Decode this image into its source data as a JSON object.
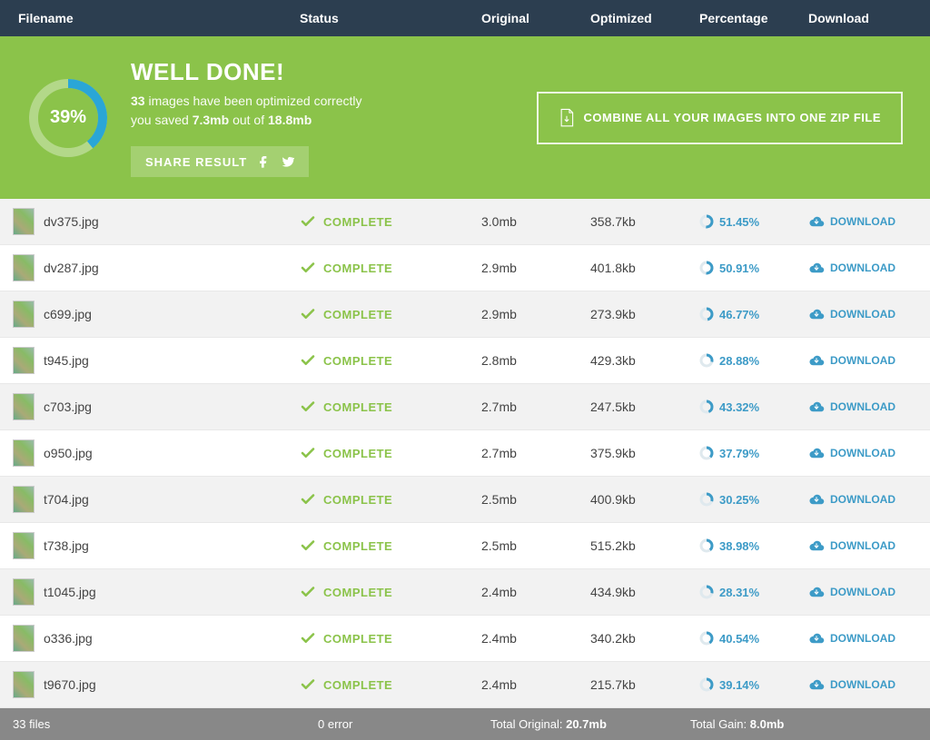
{
  "headers": {
    "file": "Filename",
    "status": "Status",
    "orig": "Original",
    "opt": "Optimized",
    "pct": "Percentage",
    "dl": "Download"
  },
  "hero": {
    "ring_pct": "39%",
    "ring_val": 39,
    "title": "WELL DONE!",
    "line1_a": "33",
    "line1_b": " images have been optimized correctly",
    "line2_a": "you saved ",
    "line2_b": "7.3mb",
    "line2_c": " out of ",
    "line2_d": "18.8mb",
    "share": "SHARE RESULT",
    "combine": "COMBINE ALL YOUR IMAGES INTO ONE ZIP FILE"
  },
  "status_label": "COMPLETE",
  "dl_label": "DOWNLOAD",
  "rows": [
    {
      "file": "dv375.jpg",
      "orig": "3.0mb",
      "opt": "358.7kb",
      "pct": "51.45%",
      "p": 51.45
    },
    {
      "file": "dv287.jpg",
      "orig": "2.9mb",
      "opt": "401.8kb",
      "pct": "50.91%",
      "p": 50.91
    },
    {
      "file": "c699.jpg",
      "orig": "2.9mb",
      "opt": "273.9kb",
      "pct": "46.77%",
      "p": 46.77
    },
    {
      "file": "t945.jpg",
      "orig": "2.8mb",
      "opt": "429.3kb",
      "pct": "28.88%",
      "p": 28.88
    },
    {
      "file": "c703.jpg",
      "orig": "2.7mb",
      "opt": "247.5kb",
      "pct": "43.32%",
      "p": 43.32
    },
    {
      "file": "o950.jpg",
      "orig": "2.7mb",
      "opt": "375.9kb",
      "pct": "37.79%",
      "p": 37.79
    },
    {
      "file": "t704.jpg",
      "orig": "2.5mb",
      "opt": "400.9kb",
      "pct": "30.25%",
      "p": 30.25
    },
    {
      "file": "t738.jpg",
      "orig": "2.5mb",
      "opt": "515.2kb",
      "pct": "38.98%",
      "p": 38.98
    },
    {
      "file": "t1045.jpg",
      "orig": "2.4mb",
      "opt": "434.9kb",
      "pct": "28.31%",
      "p": 28.31
    },
    {
      "file": "o336.jpg",
      "orig": "2.4mb",
      "opt": "340.2kb",
      "pct": "40.54%",
      "p": 40.54
    },
    {
      "file": "t9670.jpg",
      "orig": "2.4mb",
      "opt": "215.7kb",
      "pct": "39.14%",
      "p": 39.14
    }
  ],
  "footer": {
    "files": "33 files",
    "errors": "0 error",
    "tot_orig_label": "Total Original: ",
    "tot_orig_val": "20.7mb",
    "tot_gain_label": "Total Gain: ",
    "tot_gain_val": "8.0mb"
  }
}
